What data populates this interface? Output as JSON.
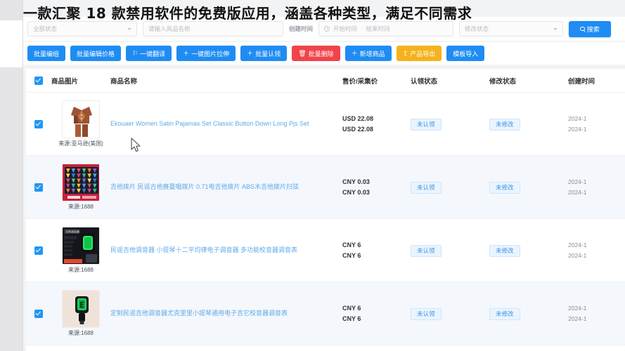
{
  "headline": "一款汇聚 18 款禁用软件的免费版应用，涵盖各种类型，满足不同需求",
  "filters": {
    "status_select": "全部状态",
    "name_placeholder": "请输入商品名称",
    "date_label": "创建时间",
    "date_start": "开始时间",
    "date_sep": "-",
    "date_end": "结束时间",
    "modify_select": "修改状态",
    "search_button": "搜索",
    "search_icon": "search-icon",
    "chevron_icon": "chevron-down-icon",
    "clock_icon": "clock-icon"
  },
  "actions": [
    {
      "label": "批量编组",
      "color": "blue",
      "icon": ""
    },
    {
      "label": "批量编辑价格",
      "color": "blue",
      "icon": ""
    },
    {
      "label": "一键翻译",
      "color": "blue",
      "icon": "⚐"
    },
    {
      "label": "一键图片拉伸",
      "color": "blue",
      "icon": "＋"
    },
    {
      "label": "批量认领",
      "color": "blue",
      "icon": "＋"
    },
    {
      "label": "批量删除",
      "color": "red",
      "icon": "🗑"
    },
    {
      "label": "新增商品",
      "color": "blue",
      "icon": "＋"
    },
    {
      "label": "产品导出",
      "color": "orange",
      "icon": "↥"
    },
    {
      "label": "模板导入",
      "color": "blue",
      "icon": ""
    }
  ],
  "table": {
    "headers": {
      "image": "商品图片",
      "name": "商品名称",
      "price": "售价/采集价",
      "claim": "认领状态",
      "modify": "修改状态",
      "time": "创建时间"
    },
    "select_all_checked": true,
    "rows": [
      {
        "checked": true,
        "source": "来源:亚马逊(美国)",
        "name": "Ekouaer Women Satin Pajamas Set Classic Button Down Long Pjs Set",
        "sale_price": "USD 22.08",
        "cost_price": "USD 22.08",
        "claim_status": "未认领",
        "modify_status": "未修改",
        "created_1": "2024-1",
        "created_2": "2024-1",
        "thumb": "satin-pajamas"
      },
      {
        "checked": true,
        "source": "来源:1688",
        "name": "吉他拨片 民谣古他赛曼唱拨片 0.71电吉他拨片 ABS木吉他拨片扫弦",
        "sale_price": "CNY 0.03",
        "cost_price": "CNY 0.03",
        "claim_status": "未认领",
        "modify_status": "未修改",
        "created_1": "2024-1",
        "created_2": "2024-1",
        "thumb": "guitar-picks"
      },
      {
        "checked": true,
        "source": "来源:1688",
        "name": "民谣吉他调音器 小提琴十二平均律电子调音器 多功能校音器调音表",
        "sale_price": "CNY 6",
        "cost_price": "CNY 6",
        "claim_status": "未认领",
        "modify_status": "未修改",
        "created_1": "2024-1",
        "created_2": "2024-1",
        "thumb": "green-tuner-box"
      },
      {
        "checked": true,
        "source": "来源:1688",
        "name": "定制民谣吉他调音器尤克里里小提琴通用电子吉它校音器调音表",
        "sale_price": "CNY 6",
        "cost_price": "CNY 6",
        "claim_status": "未认领",
        "modify_status": "未修改",
        "created_1": "2024-1",
        "created_2": "2024-1",
        "thumb": "clip-tuner"
      }
    ]
  },
  "colors": {
    "primary": "#1f8cf3",
    "danger": "#f1434a",
    "warning": "#f5b21c",
    "link": "#5fa9e8",
    "badge_bg": "#eaf4fe",
    "badge_text": "#3d93e6",
    "row_alt": "#f4f7fc"
  }
}
